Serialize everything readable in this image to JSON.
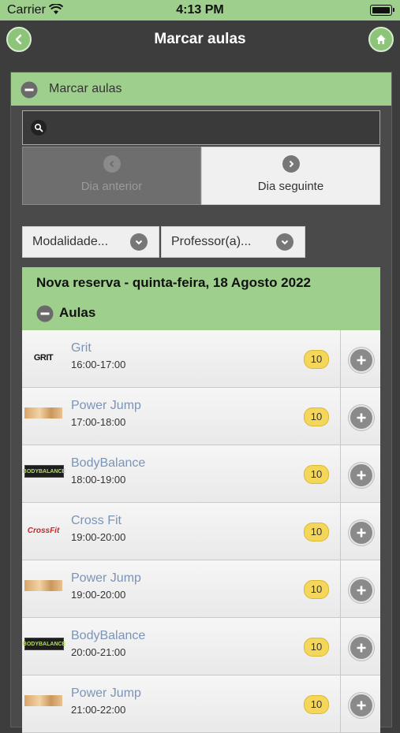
{
  "status": {
    "carrier": "Carrier",
    "time": "4:13 PM"
  },
  "header": {
    "title": "Marcar aulas",
    "back_icon": "back-arrow-icon",
    "home_icon": "home-icon"
  },
  "panel": {
    "title": "Marcar aulas"
  },
  "search": {
    "placeholder": "",
    "value": ""
  },
  "daynav": {
    "prev": "Dia anterior",
    "next": "Dia seguinte"
  },
  "filters": {
    "modalidade": "Modalidade...",
    "professor": "Professor(a)..."
  },
  "booking": {
    "title": "Nova reserva - quinta-feira, 18 Agosto 2022",
    "section": "Aulas"
  },
  "classes": [
    {
      "name": "Grit",
      "time": "16:00-17:00",
      "count": "10",
      "logo": "GRIT"
    },
    {
      "name": "Power Jump",
      "time": "17:00-18:00",
      "count": "10",
      "logo": ""
    },
    {
      "name": "BodyBalance",
      "time": "18:00-19:00",
      "count": "10",
      "logo": "BODYBALANCE"
    },
    {
      "name": "Cross Fit",
      "time": "19:00-20:00",
      "count": "10",
      "logo": "CrossFit"
    },
    {
      "name": "Power Jump",
      "time": "19:00-20:00",
      "count": "10",
      "logo": ""
    },
    {
      "name": "BodyBalance",
      "time": "20:00-21:00",
      "count": "10",
      "logo": "BODYBALANCE"
    },
    {
      "name": "Power Jump",
      "time": "21:00-22:00",
      "count": "10",
      "logo": ""
    }
  ],
  "colors": {
    "accent": "#9ecf8c",
    "background": "#3d3d3d",
    "badge": "#f4d65a",
    "link": "#7a94b8"
  }
}
